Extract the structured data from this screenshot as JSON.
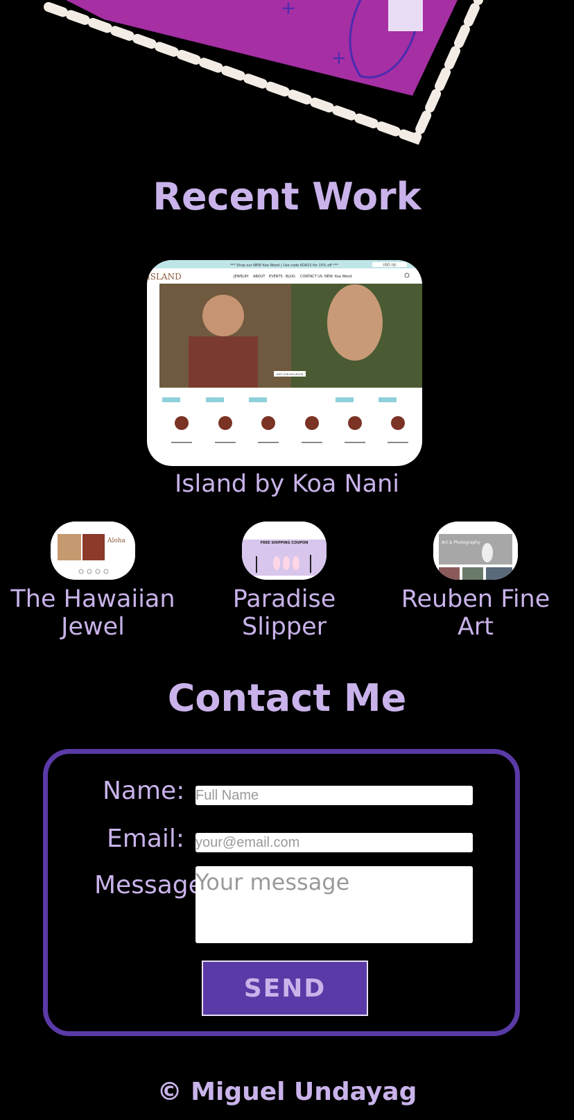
{
  "recent_work": {
    "title": "Recent Work",
    "featured": {
      "caption": "Island by Koa Nani",
      "promo_bar": "*** Shop our NEW Koa Wood | Use code KOA15 for 15% off ***",
      "currency": "USD ($)",
      "logo": "ISLAND",
      "nav": [
        "JEWELRY",
        "ABOUT",
        "EVENTS",
        "BLOG",
        "CONTACT US",
        "NEW: Koa Wood"
      ],
      "hero_button": "VISIT OUR KOA WOOD"
    },
    "projects": [
      {
        "caption": "The Hawaiian Jewel",
        "badge": "Aloha"
      },
      {
        "caption": "Paradise Slipper",
        "banner": "FREE SHIPPING COUPON"
      },
      {
        "caption": "Reuben Fine Art",
        "banner": "Art & Photography"
      }
    ]
  },
  "contact": {
    "title": "Contact Me",
    "name_label": "Name:",
    "name_placeholder": "Full Name",
    "email_label": "Email:",
    "email_placeholder": "your@email.com",
    "message_label": "Message:",
    "message_placeholder": "Your message",
    "send_label": "SEND"
  },
  "footer": {
    "copyright": "© Miguel Undayag"
  },
  "colors": {
    "background": "#000000",
    "accent_text": "#c9b3ea",
    "accent_purple": "#5a3aa6",
    "hero_magenta": "#a52fa3"
  }
}
